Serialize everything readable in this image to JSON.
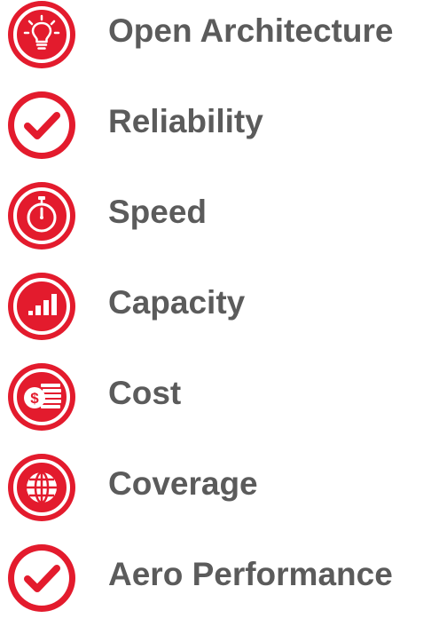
{
  "colors": {
    "accent": "#e31b2d",
    "text": "#5b5b5b",
    "ring": "#ffffff"
  },
  "features": [
    {
      "label": "Open Architecture",
      "icon": "lightbulb-icon"
    },
    {
      "label": "Reliability",
      "icon": "checkmark-icon"
    },
    {
      "label": "Speed",
      "icon": "stopwatch-icon"
    },
    {
      "label": "Capacity",
      "icon": "bar-chart-icon"
    },
    {
      "label": "Cost",
      "icon": "dollar-coins-icon"
    },
    {
      "label": "Coverage",
      "icon": "globe-icon"
    },
    {
      "label": "Aero Performance",
      "icon": "checkmark-icon"
    }
  ]
}
